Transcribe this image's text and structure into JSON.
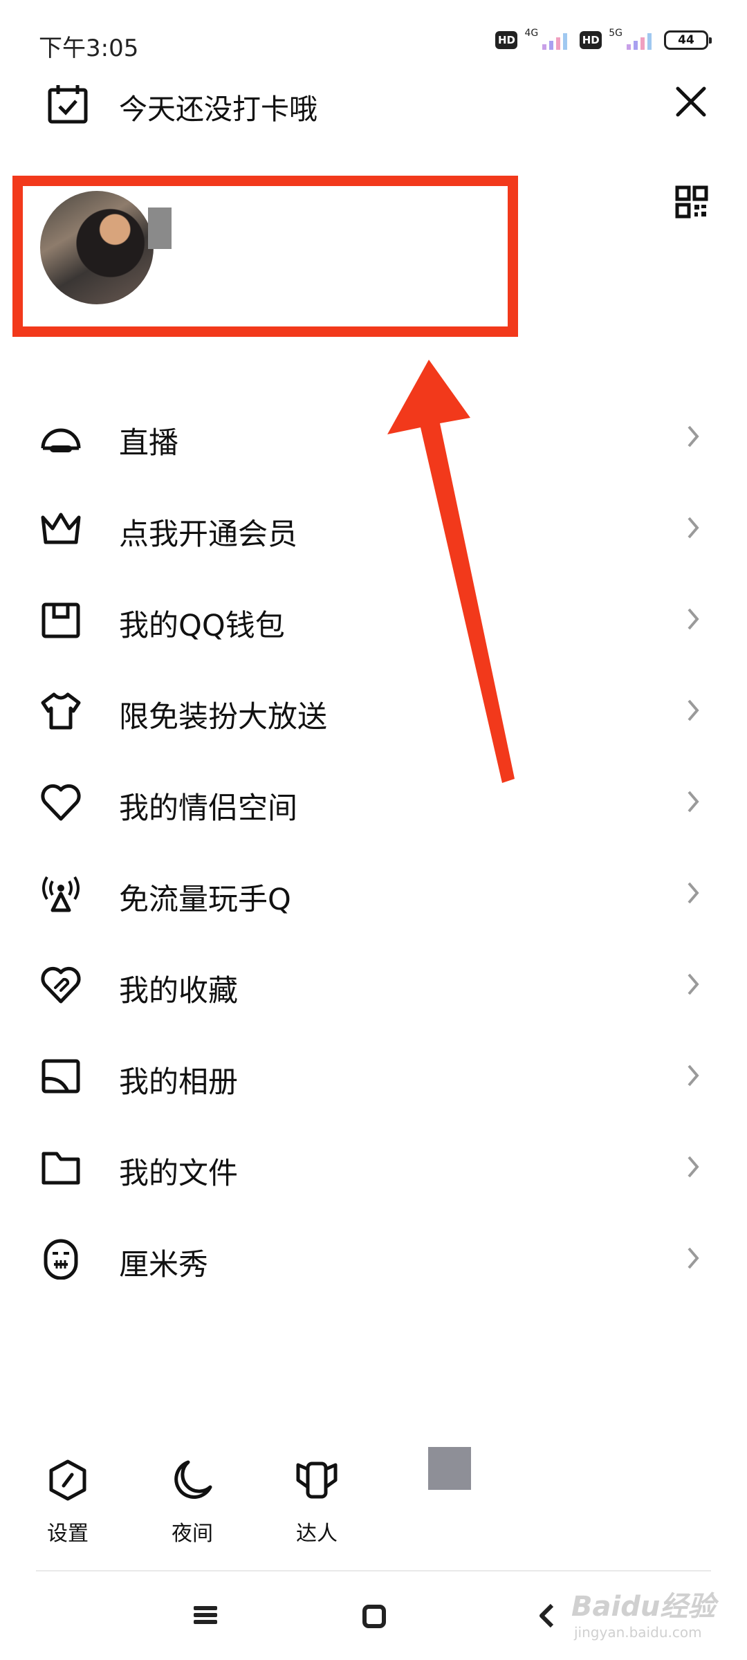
{
  "status_bar": {
    "time": "下午3:05",
    "hd_label": "HD",
    "net_1": "4G",
    "net_2": "5G",
    "battery": "44"
  },
  "header": {
    "checkin_text": "今天还没打卡哦"
  },
  "menu": [
    {
      "label": "直播",
      "icon": "live-icon"
    },
    {
      "label": "点我开通会员",
      "icon": "crown-icon"
    },
    {
      "label": "我的QQ钱包",
      "icon": "wallet-icon"
    },
    {
      "label": "限免装扮大放送",
      "icon": "tshirt-icon"
    },
    {
      "label": "我的情侣空间",
      "icon": "heart-icon"
    },
    {
      "label": "免流量玩手Q",
      "icon": "antenna-icon"
    },
    {
      "label": "我的收藏",
      "icon": "favorites-icon"
    },
    {
      "label": "我的相册",
      "icon": "album-icon"
    },
    {
      "label": "我的文件",
      "icon": "folder-icon"
    },
    {
      "label": "厘米秀",
      "icon": "cmshow-icon"
    }
  ],
  "bottom_bar": [
    {
      "label": "设置",
      "icon": "settings-icon"
    },
    {
      "label": "夜间",
      "icon": "moon-icon"
    },
    {
      "label": "达人",
      "icon": "expert-icon"
    }
  ],
  "watermark": {
    "text": "Baidu经验",
    "sub": "jingyan.baidu.com"
  },
  "colors": {
    "highlight": "#f2391b",
    "text": "#111111",
    "chevron": "#9a9a9a"
  }
}
